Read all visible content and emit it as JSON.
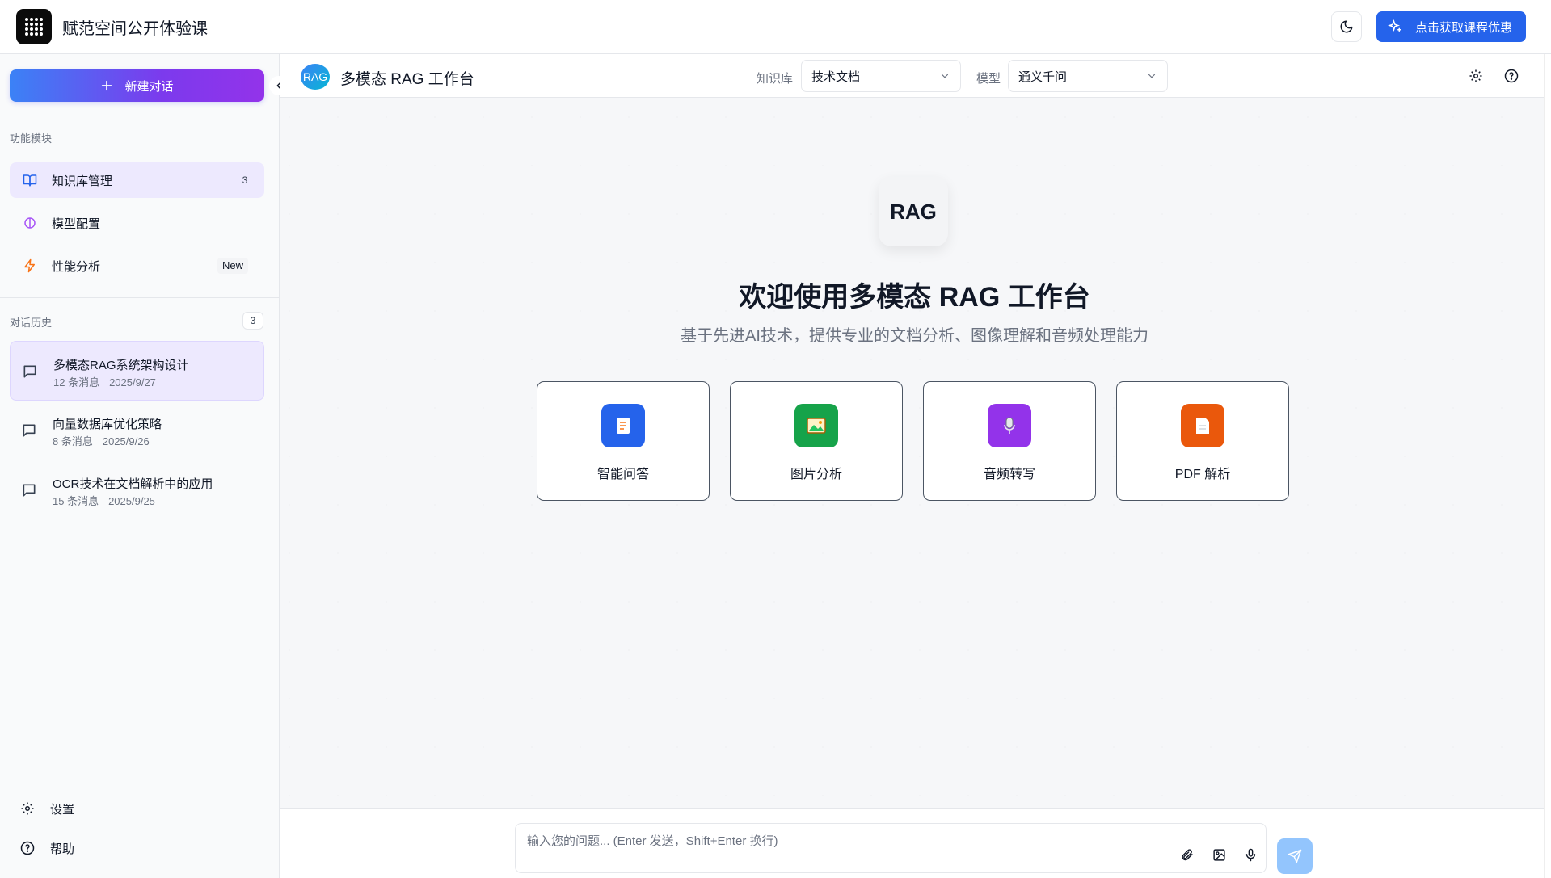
{
  "app": {
    "title": "赋范空间公开体验课",
    "logo_icon": "grid-dots-icon"
  },
  "topbar": {
    "theme_icon": "moon-icon",
    "promo_label": "点击获取课程优惠",
    "promo_icon": "sparkles-icon"
  },
  "sidebar": {
    "new_chat_label": "新建对话",
    "modules_label": "功能模块",
    "items": [
      {
        "label": "知识库管理",
        "icon": "book-open-icon",
        "count": "3",
        "active": true
      },
      {
        "label": "模型配置",
        "icon": "brain-icon",
        "active": false
      },
      {
        "label": "性能分析",
        "icon": "zap-icon",
        "badge": "New",
        "active": false
      }
    ],
    "history_label": "对话历史",
    "history_count": "3",
    "history": [
      {
        "title": "多模态RAG系统架构设计",
        "messages": "12 条消息",
        "date": "2025/9/27",
        "active": true
      },
      {
        "title": "向量数据库优化策略",
        "messages": "8 条消息",
        "date": "2025/9/26",
        "active": false
      },
      {
        "title": "OCR技术在文档解析中的应用",
        "messages": "15 条消息",
        "date": "2025/9/25",
        "active": false
      }
    ],
    "bottom": [
      {
        "label": "设置",
        "icon": "gear-icon"
      },
      {
        "label": "帮助",
        "icon": "help-circle-icon"
      }
    ]
  },
  "header": {
    "badge": "RAG",
    "title": "多模态 RAG 工作台",
    "kb_label": "知识库",
    "kb_value": "技术文档",
    "model_label": "模型",
    "model_value": "通义千问"
  },
  "hero": {
    "logo_text": "RAG",
    "title": "欢迎使用多模态 RAG 工作台",
    "subtitle": "基于先进AI技术，提供专业的文档分析、图像理解和音频处理能力"
  },
  "cards": [
    {
      "label": "智能问答",
      "icon": "memo-icon",
      "color": "#2563eb"
    },
    {
      "label": "图片分析",
      "icon": "picture-icon",
      "color": "#16a34a"
    },
    {
      "label": "音频转写",
      "icon": "microphone-icon",
      "color": "#9333ea"
    },
    {
      "label": "PDF 解析",
      "icon": "page-icon",
      "color": "#ea580c"
    }
  ],
  "input": {
    "placeholder": "输入您的问题... (Enter 发送，Shift+Enter 换行)",
    "value": ""
  }
}
